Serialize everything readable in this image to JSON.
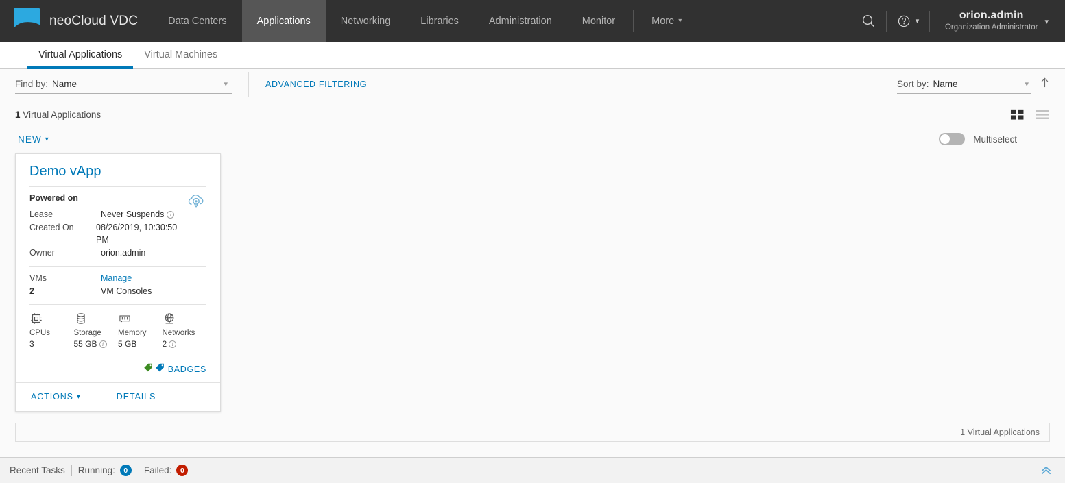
{
  "app": {
    "brand": "neoCloud VDC",
    "logo_color": "#2ca9e0",
    "header_bg": "#313131",
    "accent": "#0079b8"
  },
  "topnav": {
    "items": [
      {
        "label": "Data Centers",
        "active": false
      },
      {
        "label": "Applications",
        "active": true
      },
      {
        "label": "Networking",
        "active": false
      },
      {
        "label": "Libraries",
        "active": false
      },
      {
        "label": "Administration",
        "active": false
      },
      {
        "label": "Monitor",
        "active": false
      }
    ],
    "more_label": "More",
    "search_icon": "search-icon",
    "help_icon": "help-icon",
    "user_name": "orion.admin",
    "user_role": "Organization Administrator"
  },
  "subtabs": [
    {
      "label": "Virtual Applications",
      "active": true
    },
    {
      "label": "Virtual Machines",
      "active": false
    }
  ],
  "filter": {
    "find_by_label": "Find by:",
    "find_by_value": "Name",
    "advanced_filtering": "ADVANCED FILTERING",
    "sort_by_label": "Sort by:",
    "sort_by_value": "Name",
    "sort_direction_icon": "arrow-up-icon"
  },
  "list": {
    "count_number": "1",
    "count_suffix": " Virtual Applications",
    "grid_view_icon": "grid-view-icon",
    "list_view_icon": "list-view-icon",
    "new_label": "NEW",
    "multiselect_label": "Multiselect",
    "multiselect_on": false
  },
  "card": {
    "title": "Demo vApp",
    "power_state": "Powered on",
    "status_icon": "cloud-vapp-icon",
    "details": [
      {
        "key": "Lease",
        "value": "Never Suspends",
        "info": true
      },
      {
        "key": "Created On",
        "value": "08/26/2019, 10:30:50 PM",
        "info": false
      },
      {
        "key": "Owner",
        "value": "orion.admin",
        "info": false
      }
    ],
    "vms_key": "VMs",
    "vms_value": "2",
    "manage_link": "Manage",
    "vm_consoles_label": "VM Consoles",
    "resources": [
      {
        "label": "CPUs",
        "value": "3",
        "info": false,
        "icon": "cpu-icon"
      },
      {
        "label": "Storage",
        "value": "55 GB",
        "info": true,
        "icon": "storage-icon"
      },
      {
        "label": "Memory",
        "value": "5 GB",
        "info": false,
        "icon": "memory-icon"
      },
      {
        "label": "Networks",
        "value": "2",
        "info": true,
        "icon": "network-icon"
      }
    ],
    "badges_label": "BADGES",
    "badge_colors": [
      "#3d8b21",
      "#0079b8"
    ],
    "actions_label": "ACTIONS",
    "details_label": "DETAILS"
  },
  "pagination": {
    "summary": "1 Virtual Applications"
  },
  "footer": {
    "recent_tasks_label": "Recent Tasks",
    "running_label": "Running:",
    "running_count": "0",
    "failed_label": "Failed:",
    "failed_count": "0",
    "expand_icon": "chevron-double-up-icon"
  }
}
